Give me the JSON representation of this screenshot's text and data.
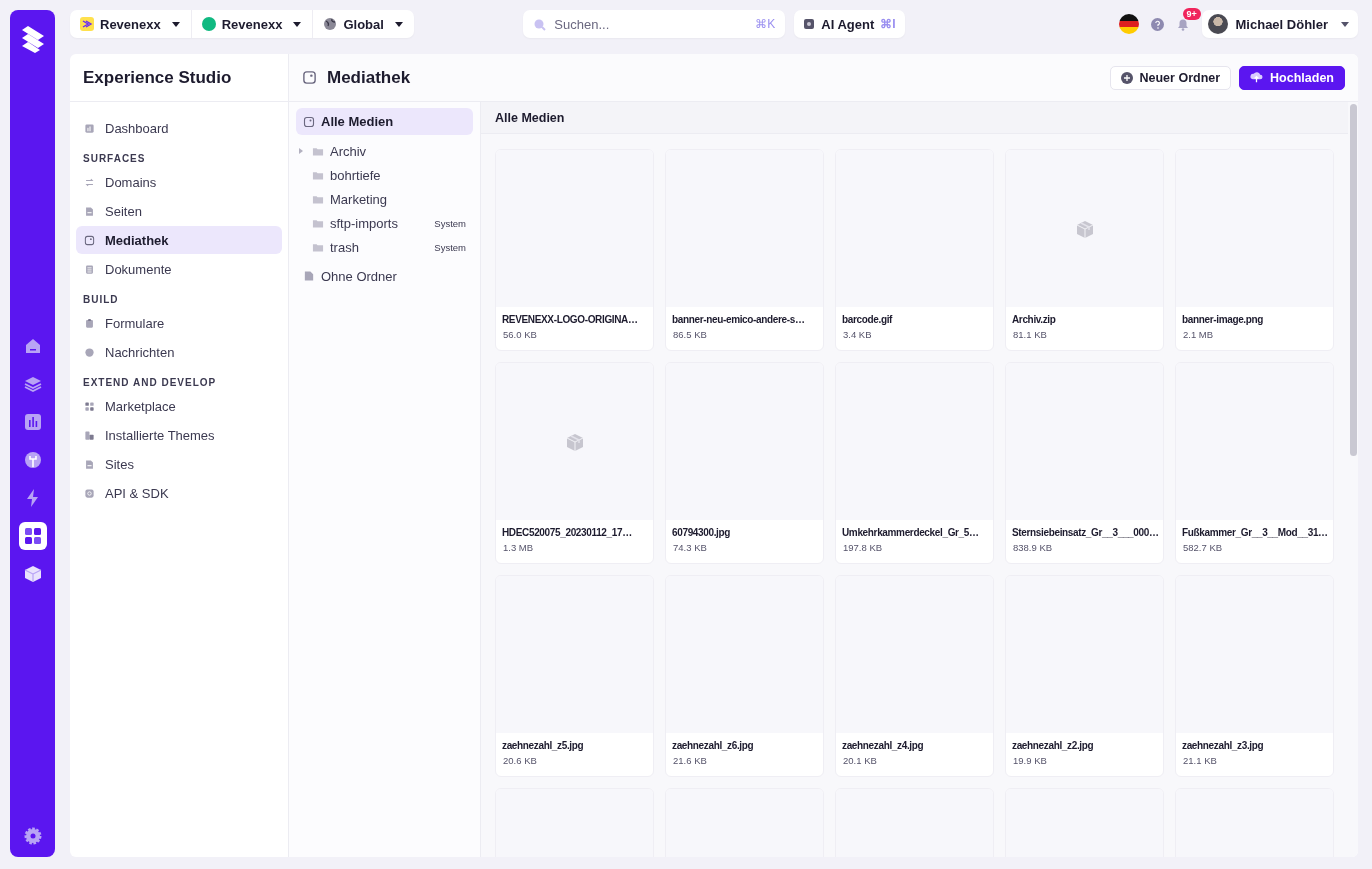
{
  "rail": {
    "items": [
      {
        "kind": "home",
        "selected": false
      },
      {
        "kind": "layers",
        "selected": false
      },
      {
        "kind": "chart",
        "selected": false
      },
      {
        "kind": "plug",
        "selected": false
      },
      {
        "kind": "bolt",
        "selected": false
      },
      {
        "kind": "grid",
        "selected": true
      },
      {
        "kind": "cube",
        "selected": false
      }
    ]
  },
  "topbar": {
    "switchers": [
      {
        "kind": "logo",
        "label": "Revenexx"
      },
      {
        "kind": "dot",
        "label": "Revenexx",
        "color": "#10b981"
      },
      {
        "kind": "globe",
        "label": "Global"
      }
    ],
    "search": {
      "placeholder": "Suchen...",
      "shortcut": "⌘K"
    },
    "agent": {
      "label": "AI Agent",
      "shortcut": "⌘I"
    },
    "notifications": {
      "badge": "9+"
    },
    "user": {
      "name": "Michael Döhler"
    }
  },
  "nav": {
    "title": "Experience Studio",
    "items": [
      {
        "kind": "item",
        "label": "Dashboard",
        "selected": false
      },
      {
        "kind": "heading",
        "label": "SURFACES"
      },
      {
        "kind": "item",
        "label": "Domains",
        "selected": false
      },
      {
        "kind": "item",
        "label": "Seiten",
        "selected": false
      },
      {
        "kind": "item",
        "label": "Mediathek",
        "selected": true
      },
      {
        "kind": "item",
        "label": "Dokumente",
        "selected": false
      },
      {
        "kind": "heading",
        "label": "BUILD"
      },
      {
        "kind": "item",
        "label": "Formulare",
        "selected": false
      },
      {
        "kind": "item",
        "label": "Nachrichten",
        "selected": false
      },
      {
        "kind": "heading",
        "label": "EXTEND AND DEVELOP"
      },
      {
        "kind": "item",
        "label": "Marketplace",
        "selected": false
      },
      {
        "kind": "item",
        "label": "Installierte Themes",
        "selected": false
      },
      {
        "kind": "item",
        "label": "Sites",
        "selected": false
      },
      {
        "kind": "item",
        "label": "API & SDK",
        "selected": false
      }
    ]
  },
  "page": {
    "title": "Mediathek",
    "buttons": [
      {
        "kind": "secondary",
        "label": "Neuer Ordner"
      },
      {
        "kind": "primary",
        "label": "Hochladen"
      }
    ]
  },
  "folders": {
    "all": {
      "label": "Alle Medien",
      "selected": true
    },
    "items": [
      {
        "label": "Archiv",
        "expandable": true
      },
      {
        "label": "bohrtiefe",
        "expandable": false
      },
      {
        "label": "Marketing",
        "expandable": false
      },
      {
        "label": "sftp-imports",
        "expandable": false,
        "badge": "System"
      },
      {
        "label": "trash",
        "expandable": false,
        "badge": "System"
      }
    ],
    "unfiled": {
      "label": "Ohne Ordner",
      "selected": false
    }
  },
  "grid": {
    "heading": "Alle Medien",
    "files": [
      {
        "name": "REVENEXX-LOGO-ORIGINA…",
        "size": "56.0 KB",
        "icon": false
      },
      {
        "name": "banner-neu-emico-andere-s…",
        "size": "86.5 KB",
        "icon": false
      },
      {
        "name": "barcode.gif",
        "size": "3.4 KB",
        "icon": false
      },
      {
        "name": "Archiv.zip",
        "size": "81.1 KB",
        "icon": true
      },
      {
        "name": "banner-image.png",
        "size": "2.1 MB",
        "icon": false
      },
      {
        "name": "HDEC520075_20230112_17…",
        "size": "1.3 MB",
        "icon": true
      },
      {
        "name": "60794300.jpg",
        "size": "74.3 KB",
        "icon": false
      },
      {
        "name": "Umkehrkammerdeckel_Gr_5…",
        "size": "197.8 KB",
        "icon": false
      },
      {
        "name": "Sternsiebeinsatz_Gr__3___000…",
        "size": "838.9 KB",
        "icon": false
      },
      {
        "name": "Fußkammer_Gr__3__Mod__31…",
        "size": "582.7 KB",
        "icon": false
      },
      {
        "name": "zaehnezahl_z5.jpg",
        "size": "20.6 KB",
        "icon": false
      },
      {
        "name": "zaehnezahl_z6.jpg",
        "size": "21.6 KB",
        "icon": false
      },
      {
        "name": "zaehnezahl_z4.jpg",
        "size": "20.1 KB",
        "icon": false
      },
      {
        "name": "zaehnezahl_z2.jpg",
        "size": "19.9 KB",
        "icon": false
      },
      {
        "name": "zaehnezahl_z3.jpg",
        "size": "21.1 KB",
        "icon": false
      }
    ],
    "cut_off_cards": [
      {
        "kind": "file"
      },
      {
        "kind": "file"
      },
      {
        "kind": "file"
      },
      {
        "kind": "file"
      },
      {
        "kind": "file"
      }
    ]
  }
}
